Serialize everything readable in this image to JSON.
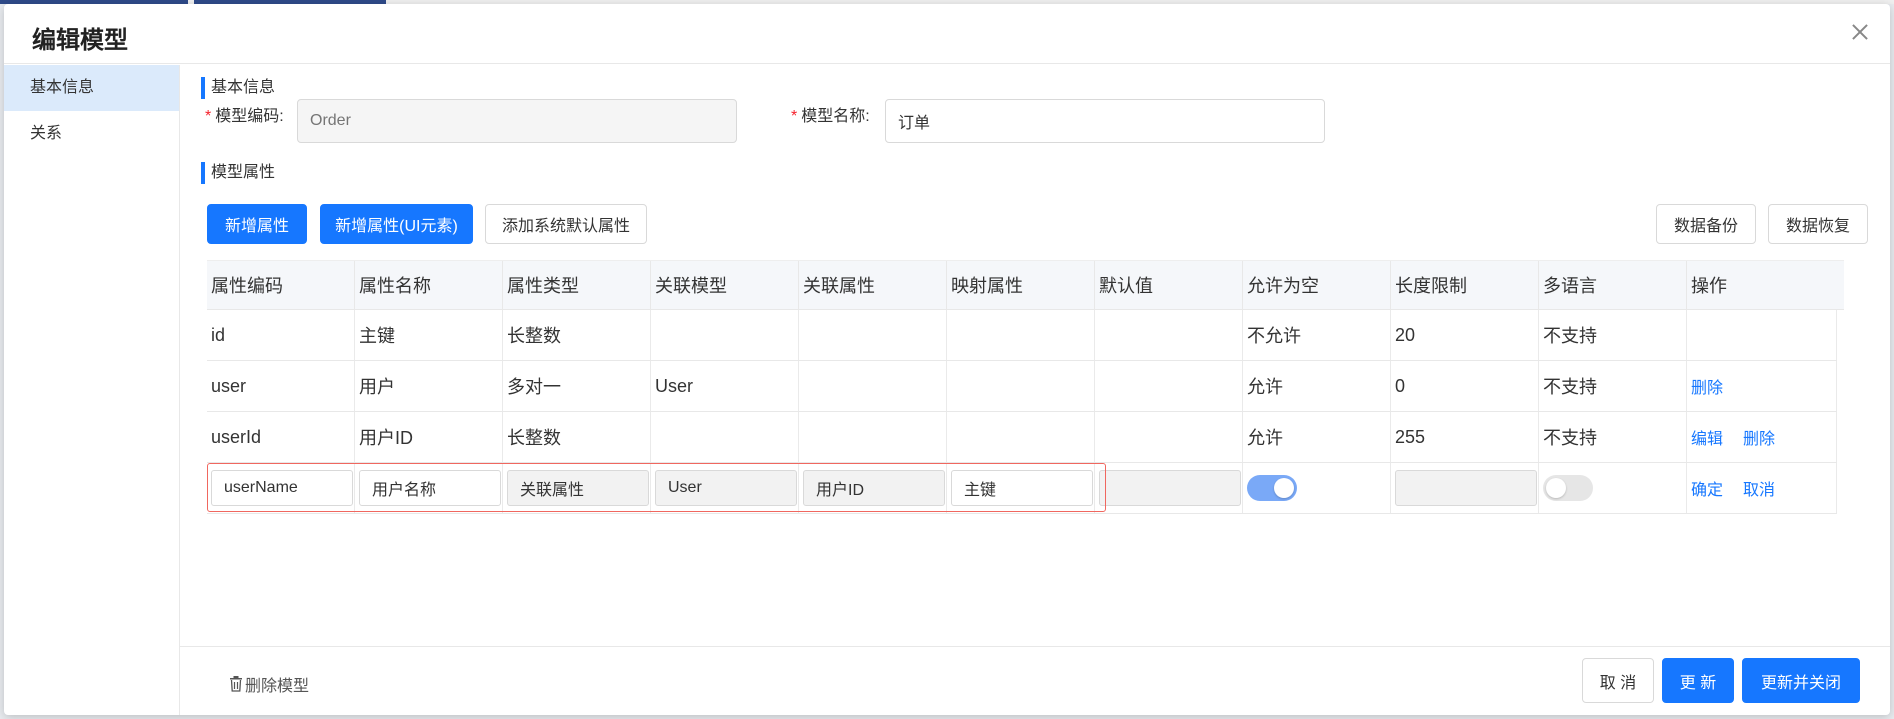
{
  "modal": {
    "title": "编辑模型"
  },
  "sidebar": {
    "items": [
      {
        "label": "基本信息",
        "active": true
      },
      {
        "label": "关系",
        "active": false
      }
    ]
  },
  "basic_info": {
    "section_title": "基本信息",
    "model_code": {
      "label": "模型编码:",
      "placeholder": "Order"
    },
    "model_name": {
      "label": "模型名称:",
      "value": "订单"
    }
  },
  "attributes": {
    "section_title": "模型属性",
    "buttons": {
      "add_attr": "新增属性",
      "add_attr_ui": "新增属性(UI元素)",
      "add_default": "添加系统默认属性",
      "backup": "数据备份",
      "restore": "数据恢复"
    },
    "columns": [
      "属性编码",
      "属性名称",
      "属性类型",
      "关联模型",
      "关联属性",
      "映射属性",
      "默认值",
      "允许为空",
      "长度限制",
      "多语言",
      "操作"
    ],
    "rows": [
      {
        "code": "id",
        "name": "主键",
        "type": "长整数",
        "rel_model": "",
        "rel_attr": "",
        "map_attr": "",
        "default": "",
        "nullable": "不允许",
        "length": "20",
        "i18n": "不支持",
        "actions": []
      },
      {
        "code": "user",
        "name": "用户",
        "type": "多对一",
        "rel_model": "User",
        "rel_attr": "",
        "map_attr": "",
        "default": "",
        "nullable": "允许",
        "length": "0",
        "i18n": "不支持",
        "actions": [
          "删除"
        ]
      },
      {
        "code": "userId",
        "name": "用户ID",
        "type": "长整数",
        "rel_model": "",
        "rel_attr": "",
        "map_attr": "",
        "default": "",
        "nullable": "允许",
        "length": "255",
        "i18n": "不支持",
        "actions": [
          "编辑",
          "删除"
        ]
      }
    ],
    "edit_row": {
      "code": "userName",
      "name": "用户名称",
      "type": "关联属性",
      "rel_model": "User",
      "rel_attr": "用户ID",
      "map_attr": "主键",
      "nullable_on": true,
      "i18n_on": false,
      "confirm": "确定",
      "cancel": "取消"
    }
  },
  "footer": {
    "delete_model": "删除模型",
    "cancel": "取 消",
    "update": "更 新",
    "update_close": "更新并关闭"
  },
  "colors": {
    "primary": "#1677ff",
    "highlight": "#f0675f",
    "active_side": "#dbeafb"
  }
}
